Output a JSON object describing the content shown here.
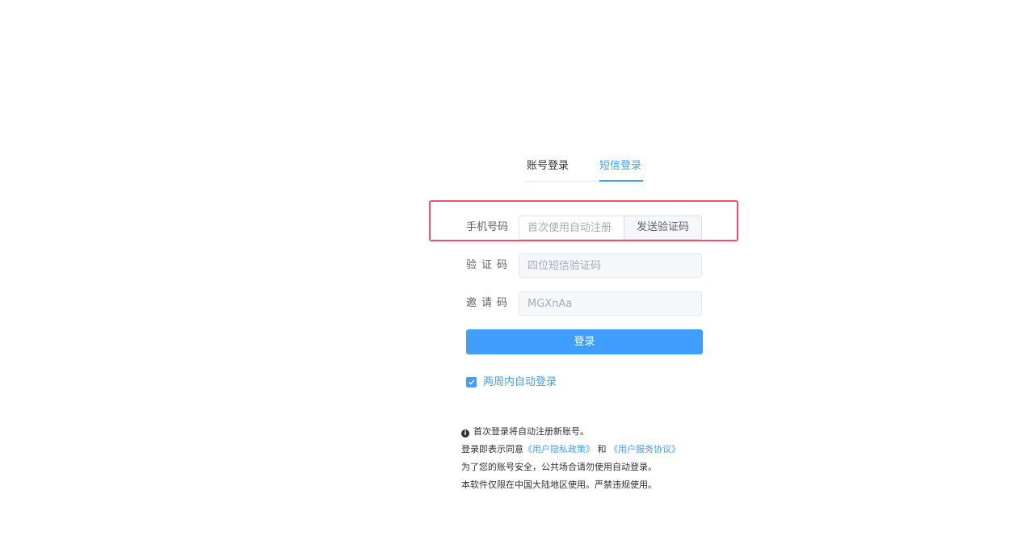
{
  "tabs": {
    "account": "账号登录",
    "sms": "短信登录"
  },
  "form": {
    "phone_label": "手机号码",
    "phone_placeholder": "首次使用自动注册",
    "send_code": "发送验证码",
    "code_label": "验证码",
    "code_placeholder": "四位短信验证码",
    "invite_label": "邀请码",
    "invite_value": "MGXnAa",
    "login_button": "登录",
    "remember_label": "两周内自动登录",
    "remember_checked": true
  },
  "notes": {
    "line1": "首次登录将自动注册新账号。",
    "line2_prefix": "登录即表示同意",
    "privacy_link": "《用户隐私政策》",
    "and": "和",
    "service_link": "《用户服务协议》",
    "line3": "为了您的账号安全，公共场合请勿使用自动登录。",
    "line4": "本软件仅限在中国大陆地区使用。严禁违规使用。"
  },
  "colors": {
    "accent": "#409eff",
    "highlight": "#f0506e"
  }
}
